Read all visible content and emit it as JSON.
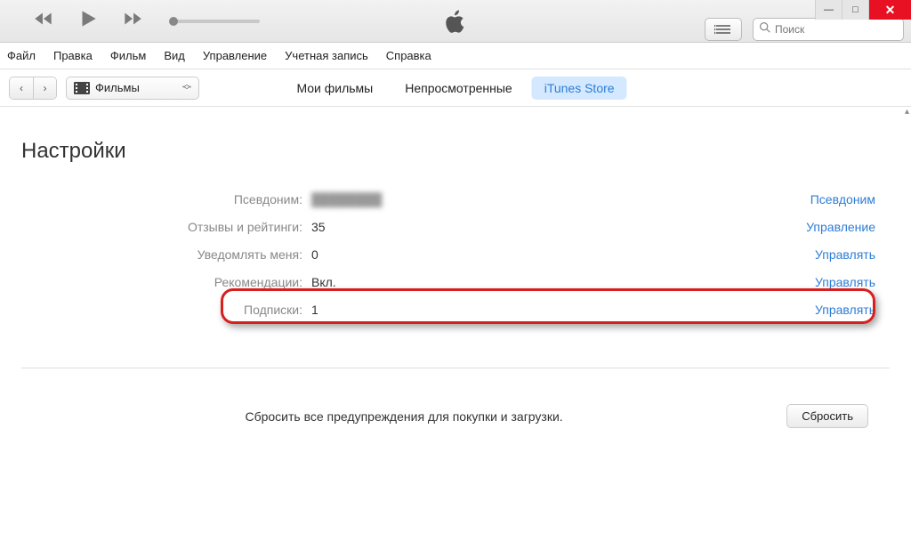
{
  "window": {
    "minimize": "—",
    "maximize": "□",
    "close": "✕"
  },
  "search": {
    "placeholder": "Поиск"
  },
  "menubar": [
    "Файл",
    "Правка",
    "Фильм",
    "Вид",
    "Управление",
    "Учетная запись",
    "Справка"
  ],
  "nav": {
    "back": "‹",
    "forward": "›",
    "media_label": "Фильмы",
    "tabs": [
      {
        "label": "Мои фильмы",
        "active": false
      },
      {
        "label": "Непросмотренные",
        "active": false
      },
      {
        "label": "iTunes Store",
        "active": true
      }
    ]
  },
  "page": {
    "title": "Настройки",
    "rows": [
      {
        "label": "Псевдоним:",
        "value": "████████",
        "action": "Псевдоним",
        "blur": true
      },
      {
        "label": "Отзывы и рейтинги:",
        "value": "35",
        "action": "Управление"
      },
      {
        "label": "Уведомлять меня:",
        "value": "0",
        "action": "Управлять"
      },
      {
        "label": "Рекомендации:",
        "value": "Вкл.",
        "action": "Управлять"
      },
      {
        "label": "Подписки:",
        "value": "1",
        "action": "Управлять"
      }
    ],
    "reset_text": "Сбросить все предупреждения для покупки и загрузки.",
    "reset_button": "Сбросить"
  }
}
